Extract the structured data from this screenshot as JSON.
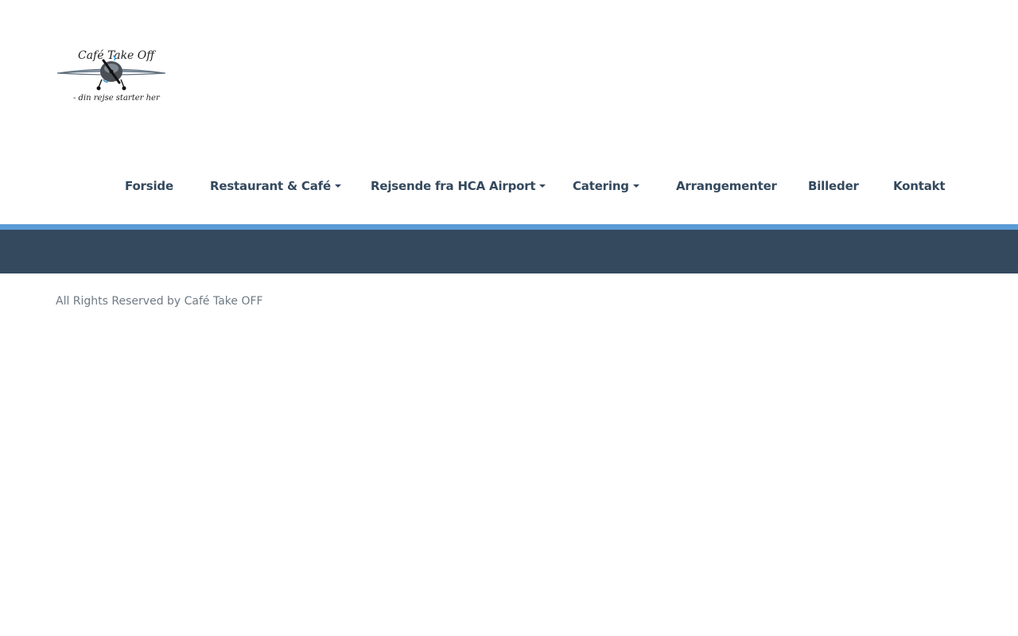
{
  "logo": {
    "text_line1": "Café Take Off",
    "text_line2": "- din rejse starter her",
    "icon": "airplane-icon"
  },
  "nav": {
    "items": [
      {
        "label": "Forside",
        "has_dropdown": false
      },
      {
        "label": "Restaurant & Café",
        "has_dropdown": true
      },
      {
        "label": "Rejsende fra HCA Airport",
        "has_dropdown": true
      },
      {
        "label": "Catering",
        "has_dropdown": true
      },
      {
        "label": "Arrangementer",
        "has_dropdown": false
      },
      {
        "label": "Billeder",
        "has_dropdown": false
      },
      {
        "label": "Kontakt",
        "has_dropdown": false
      }
    ]
  },
  "footer": {
    "copyright": "All Rights Reserved by Café Take OFF"
  },
  "colors": {
    "nav_text": "#34495e",
    "accent_bar": "#5b9bd5",
    "dark_band": "#34495e",
    "footer_text": "#6f7a84"
  }
}
